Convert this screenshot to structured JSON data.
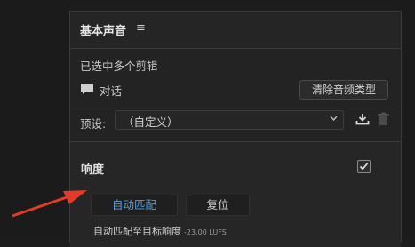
{
  "panel": {
    "title": "基本声音",
    "selection_status": "已选中多个剪辑",
    "dialog_label": "对话",
    "clear_audio_type_label": "清除音频类型",
    "preset_label": "预设:",
    "preset_value": "（自定义）"
  },
  "loudness": {
    "title": "响度",
    "checked": true,
    "auto_match_label": "自动匹配",
    "reset_label": "复位",
    "match_text": "自动匹配至目标响度",
    "match_value": "-23.00 LUFS"
  },
  "icons": {
    "menu": "hamburger-menu-icon",
    "dialog": "speech-bubble-icon",
    "dropdown": "chevron-down-icon",
    "save_preset": "download-save-icon",
    "delete_preset": "trash-icon",
    "checkbox": "checkmark-icon",
    "annotation": "red-arrow-icon"
  },
  "colors": {
    "accent_text": "#5b9ad8",
    "annotation_arrow": "#e23b2a"
  }
}
